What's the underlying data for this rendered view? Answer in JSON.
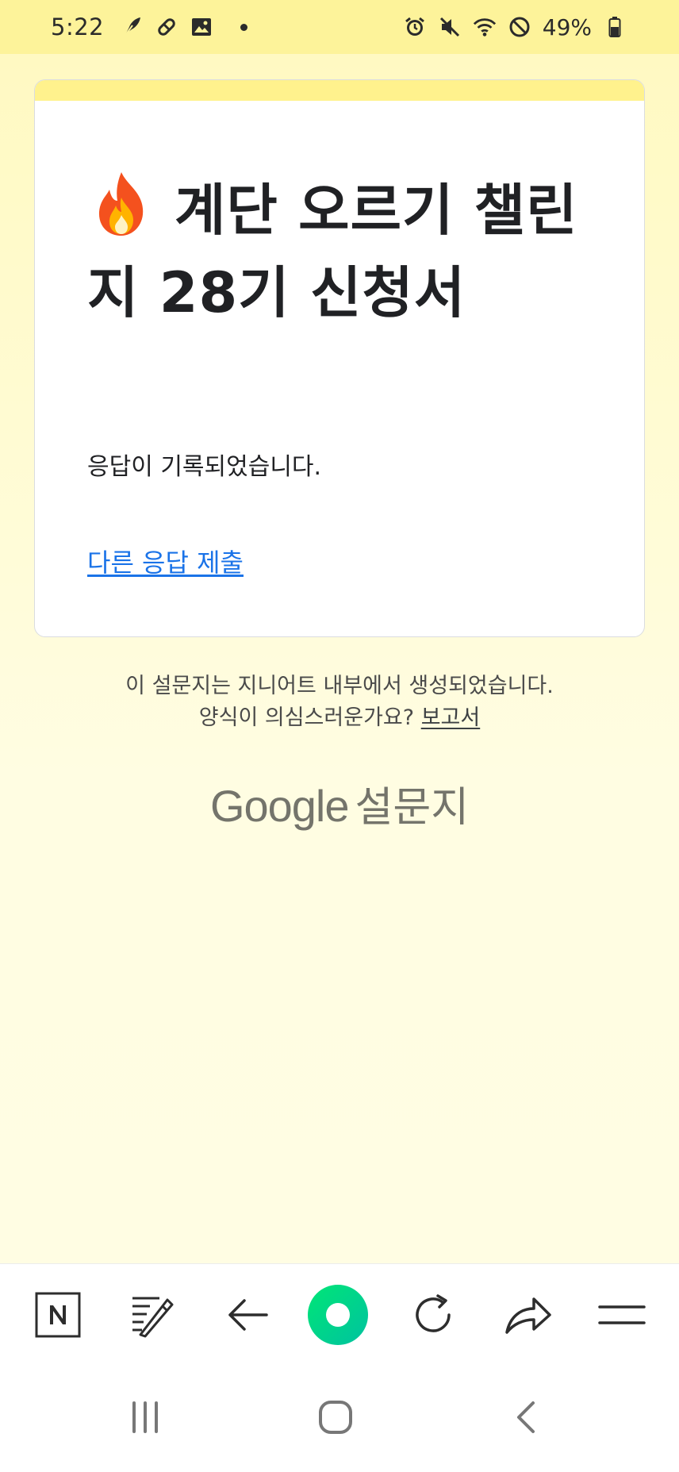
{
  "status_bar": {
    "time": "5:22",
    "battery": "49%",
    "left_icons": [
      "feather-icon",
      "pill-icon",
      "image-icon",
      "dot-icon"
    ],
    "right_icons": [
      "alarm-icon",
      "mute-icon",
      "wifi-icon",
      "do-not-disturb-icon",
      "battery-icon"
    ]
  },
  "card": {
    "title": "계단 오르기 챌린지 28기 신청서",
    "title_emoji": "fire-icon",
    "message": "응답이 기록되었습니다.",
    "link": "다른 응답 제출"
  },
  "footer": {
    "line1": "이 설문지는 지니어트 내부에서 생성되었습니다.",
    "line2_prefix": "양식이 의심스러운가요?",
    "report_link": "보고서",
    "logo_google": "Google",
    "logo_forms": "설문지"
  },
  "toolbar": {
    "buttons": [
      "naver-icon",
      "edit-icon",
      "back-arrow-icon",
      "green-dot-icon",
      "refresh-icon",
      "share-icon",
      "menu-icon"
    ]
  },
  "system_nav": {
    "buttons": [
      "recents-icon",
      "home-icon",
      "back-icon"
    ]
  },
  "colors": {
    "status_bar_bg": "#fdf39a",
    "card_accent": "#fff28d",
    "page_bg": "#fffde2",
    "link": "#1a73e8",
    "green_button": "#03cf5d"
  }
}
